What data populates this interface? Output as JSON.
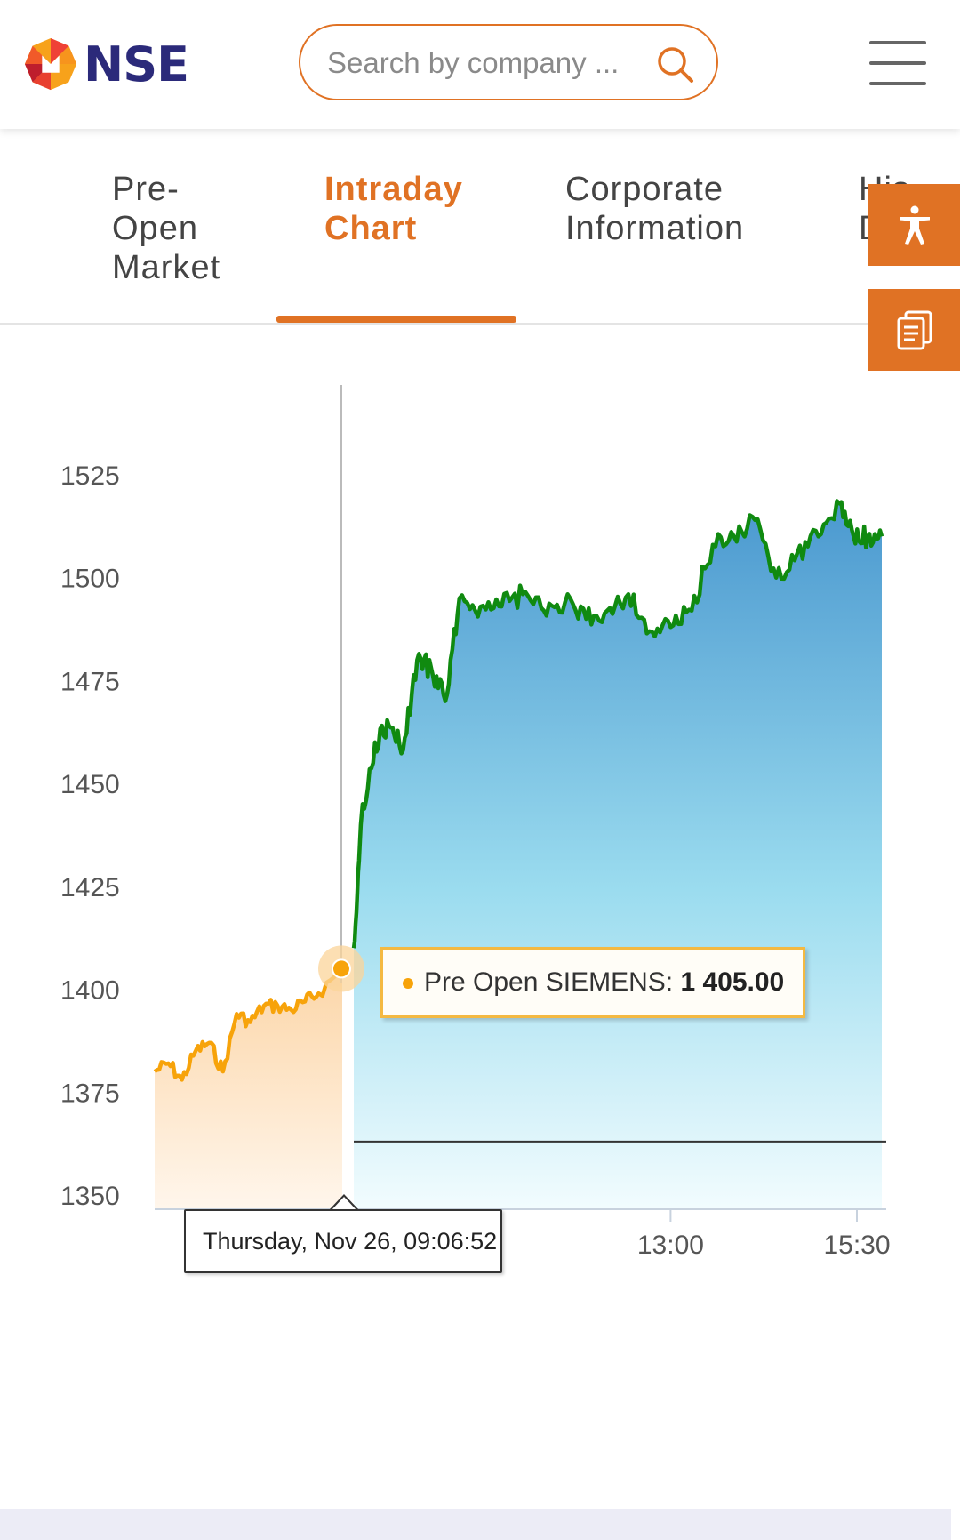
{
  "header": {
    "logo_text": "NSE",
    "search_placeholder": "Search by company ...",
    "brand_color": "#e07224",
    "logo_color": "#2b2a7a",
    "icons": [
      "nse-logo-icon",
      "search-icon",
      "hamburger-menu-icon"
    ]
  },
  "tabs": [
    {
      "line1": "Pre-",
      "line2": "Open",
      "line3": "Market"
    },
    {
      "line1": "Intraday",
      "line2": "Chart",
      "line3": ""
    },
    {
      "line1": "Corporate",
      "line2": "Information",
      "line3": ""
    },
    {
      "line1": "His",
      "line2": "D",
      "line3": ""
    }
  ],
  "side_buttons": [
    "accessibility-icon",
    "document-icon"
  ],
  "tooltip": {
    "series": "Pre Open SIEMENS:",
    "value": "1 405.00"
  },
  "x_tooltip": "Thursday, Nov 26, 09:06:52",
  "chart_data": {
    "type": "area",
    "title": "",
    "xlabel": "",
    "ylabel": "",
    "ylim": [
      1350,
      1535
    ],
    "y_ticks": [
      "1525",
      "1500",
      "1475",
      "1450",
      "1425",
      "1400",
      "1375",
      "1350"
    ],
    "y_tick_values": [
      1525,
      1500,
      1475,
      1450,
      1425,
      1400,
      1375,
      1350
    ],
    "x_ticks": [
      "13:00",
      "15:30"
    ],
    "grid": false,
    "reference_line": 1363,
    "colors": {
      "preopen_line": "#f7a30a",
      "market_line": "#108a10",
      "market_fill_top": "#4a98cf",
      "market_fill_bottom": "#eaf8fc",
      "preopen_fill": "#fde2c2"
    },
    "series": [
      {
        "name": "Pre Open SIEMENS",
        "x": [
          "09:00",
          "09:00:30",
          "09:01",
          "09:01:30",
          "09:02",
          "09:02:30",
          "09:03",
          "09:03:30",
          "09:04",
          "09:04:30",
          "09:05",
          "09:05:30",
          "09:06",
          "09:06:52"
        ],
        "y": [
          1380,
          1382,
          1378,
          1385,
          1387,
          1380,
          1394,
          1392,
          1396,
          1396,
          1395,
          1397,
          1399,
          1405
        ]
      },
      {
        "name": "SIEMENS",
        "x": [
          "09:15",
          "09:20",
          "09:30",
          "09:40",
          "09:50",
          "10:00",
          "10:10",
          "10:20",
          "10:30",
          "10:45",
          "11:00",
          "11:15",
          "11:30",
          "11:45",
          "12:00",
          "12:15",
          "12:30",
          "12:45",
          "13:00",
          "13:15",
          "13:30",
          "13:45",
          "14:00",
          "14:15",
          "14:30",
          "14:45",
          "15:00",
          "15:10",
          "15:20",
          "15:30"
        ],
        "y": [
          1410,
          1440,
          1460,
          1464,
          1458,
          1480,
          1478,
          1470,
          1495,
          1493,
          1493,
          1496,
          1492,
          1494,
          1490,
          1492,
          1496,
          1487,
          1488,
          1492,
          1508,
          1510,
          1514,
          1500,
          1506,
          1510,
          1518,
          1510,
          1510,
          1510
        ]
      }
    ]
  }
}
